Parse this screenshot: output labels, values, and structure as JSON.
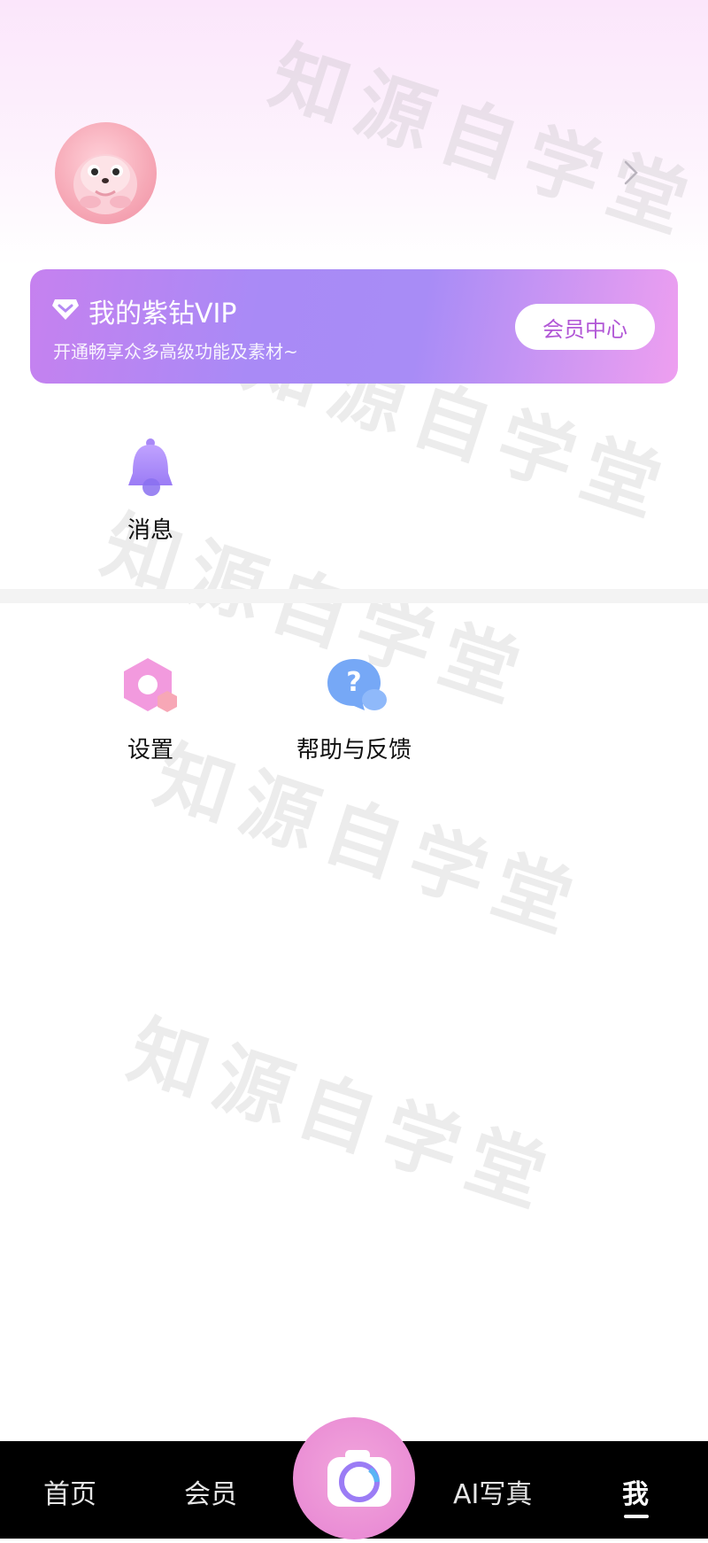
{
  "profile": {
    "avatar_alt": "seal-mascot-avatar"
  },
  "vip_card": {
    "title": "我的紫钻VIP",
    "subtitle": "开通畅享众多高级功能及素材~",
    "button_label": "会员中心"
  },
  "menu_top": [
    {
      "label": "消息",
      "icon": "bell-icon"
    }
  ],
  "menu_bottom": [
    {
      "label": "设置",
      "icon": "gear-icon"
    },
    {
      "label": "帮助与反馈",
      "icon": "help-bubble-icon"
    }
  ],
  "tabbar": {
    "tabs": [
      {
        "label": "首页"
      },
      {
        "label": "会员"
      },
      {
        "label": "AI写真"
      },
      {
        "label": "我"
      }
    ],
    "active_tab": "我"
  },
  "watermark_text": "知源自学堂",
  "colors": {
    "accent_purple": "#a88cf6",
    "accent_pink": "#ee9ff0",
    "vip_button_text": "#b157d6"
  }
}
